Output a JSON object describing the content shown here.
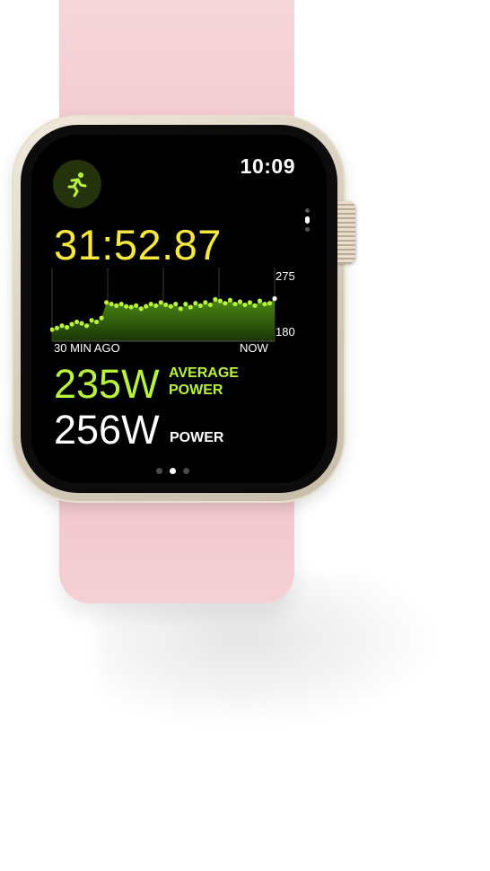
{
  "status_bar": {
    "time": "10:09"
  },
  "workout": {
    "icon": "running-figure-icon",
    "elapsed_time": "31:52.87"
  },
  "power_chart": {
    "y_max_label": "275",
    "y_min_label": "180",
    "x_start_label": "30 MIN AGO",
    "x_end_label": "NOW",
    "color": "#b6f33a"
  },
  "metrics": {
    "average_power_value": "235W",
    "average_power_label_line1": "AVERAGE",
    "average_power_label_line2": "POWER",
    "power_value": "256W",
    "power_label": "POWER"
  },
  "colors": {
    "elapsed": "#f7e93b",
    "accent_green": "#b6f33a",
    "band": "#f3cdd2"
  },
  "pagination": {
    "pages": 3,
    "active_index": 1
  },
  "chart_data": {
    "type": "area",
    "title": "",
    "xlabel": "",
    "ylabel": "",
    "x_labels": [
      "30 MIN AGO",
      "NOW"
    ],
    "ylim": [
      180,
      275
    ],
    "series": [
      {
        "values": [
          195,
          197,
          200,
          198,
          202,
          205,
          203,
          200,
          207,
          205,
          210,
          230,
          228,
          226,
          228,
          225,
          224,
          226,
          222,
          225,
          228,
          226,
          230,
          227,
          225,
          228,
          222,
          228,
          224,
          229,
          226,
          230,
          227,
          234,
          232,
          229,
          233,
          228,
          231,
          227,
          230,
          226,
          232,
          228,
          229,
          235
        ]
      }
    ]
  }
}
